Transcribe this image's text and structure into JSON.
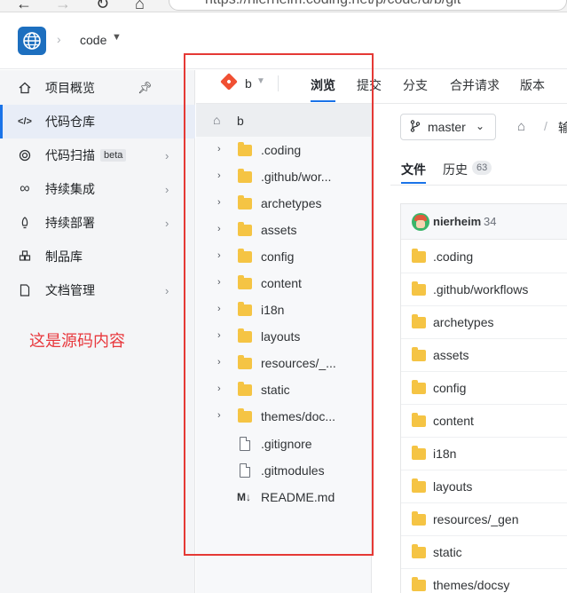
{
  "browser": {
    "url": "https://nierheim.coding.net/p/code/d/b/git"
  },
  "header": {
    "logo_icon": "globe-icon",
    "project": "code",
    "accent": "#1d6fbf"
  },
  "sidebar": {
    "items": [
      {
        "label": "项目概览",
        "icon": "home-icon"
      },
      {
        "label": "代码仓库",
        "icon": "code-icon"
      },
      {
        "label": "代码扫描",
        "icon": "scan-icon",
        "badge": "beta"
      },
      {
        "label": "持续集成",
        "icon": "infinity-icon"
      },
      {
        "label": "持续部署",
        "icon": "rocket-icon"
      },
      {
        "label": "制品库",
        "icon": "artifact-icon"
      },
      {
        "label": "文档管理",
        "icon": "document-icon"
      }
    ],
    "annotation": "这是源码内容"
  },
  "tabs": {
    "repo": "b",
    "items": [
      "浏览",
      "提交",
      "分支",
      "合并请求",
      "版本"
    ]
  },
  "tree": {
    "root": "b",
    "folders": [
      ".coding",
      ".github/wor...",
      "archetypes",
      "assets",
      "config",
      "content",
      "i18n",
      "layouts",
      "resources/_...",
      "static",
      "themes/doc..."
    ],
    "files": [
      ".gitignore",
      ".gitmodules"
    ],
    "readme_tag": "M↓",
    "readme": "README.md"
  },
  "main": {
    "branch": "master",
    "crumb": "输",
    "subtabs": {
      "files": "文件",
      "history": "历史",
      "history_count": "63"
    },
    "commit": {
      "user": "nierheim",
      "count": "34"
    },
    "folders": [
      ".coding",
      ".github/workflows",
      "archetypes",
      "assets",
      "config",
      "content",
      "i18n",
      "layouts",
      "resources/_gen",
      "static",
      "themes/docsy"
    ]
  }
}
